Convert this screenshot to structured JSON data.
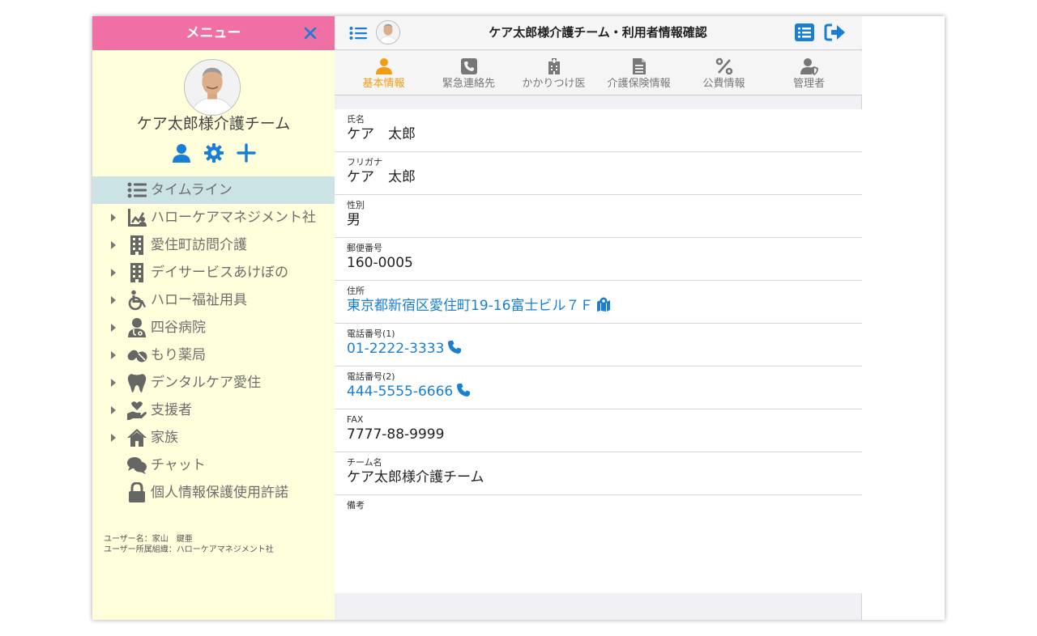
{
  "colors": {
    "menu_header": "#f06fa4",
    "sidebar_bg": "#ffffdc",
    "active_nav": "#cbe3e5",
    "accent_blue": "#1a7fd4",
    "tab_active": "#f39c12"
  },
  "sidebar": {
    "title": "メニュー",
    "team_name": "ケア太郎様介護チーム",
    "team_actions": [
      "user-icon",
      "gear-icon",
      "plus-icon"
    ],
    "items": [
      {
        "label": "タイムライン",
        "icon": "list-icon",
        "expandable": false,
        "active": true
      },
      {
        "label": "ハローケアマネジメント社",
        "icon": "chart-user-icon",
        "expandable": true
      },
      {
        "label": "愛住町訪問介護",
        "icon": "building-icon",
        "expandable": true
      },
      {
        "label": "デイサービスあけぼの",
        "icon": "building-icon",
        "expandable": true
      },
      {
        "label": "ハロー福祉用具",
        "icon": "wheelchair-icon",
        "expandable": true
      },
      {
        "label": "四谷病院",
        "icon": "doctor-icon",
        "expandable": true
      },
      {
        "label": "もり薬局",
        "icon": "pills-icon",
        "expandable": true
      },
      {
        "label": "デンタルケア愛住",
        "icon": "tooth-icon",
        "expandable": true
      },
      {
        "label": "支援者",
        "icon": "hand-heart-icon",
        "expandable": true
      },
      {
        "label": "家族",
        "icon": "home-icon",
        "expandable": true
      },
      {
        "label": "チャット",
        "icon": "chat-icon",
        "expandable": false
      },
      {
        "label": "個人情報保護使用許諾",
        "icon": "lock-icon",
        "expandable": false
      }
    ],
    "user_name_line": "ユーザー名：家山　鍵亜",
    "user_org_line": "ユーザー所属組織：ハローケアマネジメント社"
  },
  "header": {
    "title": "ケア太郎様介護チーム・利用者情報確認"
  },
  "tabs": [
    {
      "label": "基本情報",
      "icon": "user-icon",
      "active": true
    },
    {
      "label": "緊急連絡先",
      "icon": "phone-square-icon"
    },
    {
      "label": "かかりつけ医",
      "icon": "hospital-icon"
    },
    {
      "label": "介護保険情報",
      "icon": "document-icon"
    },
    {
      "label": "公費情報",
      "icon": "percent-icon"
    },
    {
      "label": "管理者",
      "icon": "user-shield-icon"
    }
  ],
  "fields": [
    {
      "label": "氏名",
      "value": "ケア　太郎"
    },
    {
      "label": "フリガナ",
      "value": "ケア　太郎"
    },
    {
      "label": "性別",
      "value": "男"
    },
    {
      "label": "郵便番号",
      "value": "160-0005"
    },
    {
      "label": "住所",
      "value": "東京都新宿区愛住町19-16富士ビル７Ｆ",
      "link": true,
      "icon": "map-marker-icon"
    },
    {
      "label": "電話番号(1)",
      "value": "01-2222-3333",
      "link": true,
      "icon": "phone-icon"
    },
    {
      "label": "電話番号(2)",
      "value": "444-5555-6666",
      "link": true,
      "icon": "phone-icon"
    },
    {
      "label": "FAX",
      "value": "7777-88-9999"
    },
    {
      "label": "チーム名",
      "value": "ケア太郎様介護チーム"
    },
    {
      "label": "備考",
      "value": ""
    }
  ]
}
